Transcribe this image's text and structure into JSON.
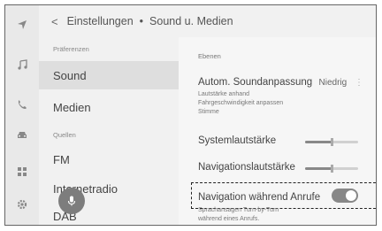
{
  "breadcrumb": {
    "parent": "Einstellungen",
    "separator": "•",
    "current": "Sound u. Medien"
  },
  "left_panel": {
    "sections": [
      {
        "heading": "Präferenzen",
        "items": [
          {
            "label": "Sound",
            "selected": true
          },
          {
            "label": "Medien",
            "selected": false
          }
        ]
      },
      {
        "heading": "Quellen",
        "items": [
          {
            "label": "FM",
            "selected": false
          },
          {
            "label": "Internetradio",
            "selected": false
          },
          {
            "label": "DAB",
            "selected": false
          }
        ]
      }
    ]
  },
  "right_panel": {
    "section_heading": "Ebenen",
    "auto_sound": {
      "label": "Autom. Soundanpassung",
      "value": "Niedrig",
      "desc_line1": "Lautstärke anhand",
      "desc_line2": "Fahrgeschwindigkeit anpassen",
      "desc_line3": "Stimme"
    },
    "system_volume": {
      "label": "Systemlautstärke",
      "level": 0.5
    },
    "nav_volume": {
      "label": "Navigationslautstärke",
      "level": 0.5
    },
    "nav_during_calls": {
      "label": "Navigation während Anrufe",
      "desc_line1": "Sprachansagen Turn-by-Turn",
      "desc_line2": "während eines Anrufs.",
      "enabled": true
    }
  },
  "rail_icons": [
    "navigation-arrow-icon",
    "music-note-icon",
    "phone-icon",
    "car-icon",
    "apps-grid-icon",
    "settings-gear-icon"
  ],
  "colors": {
    "accent": "#888888",
    "background": "#f1f1f1",
    "selected": "#dedede"
  }
}
